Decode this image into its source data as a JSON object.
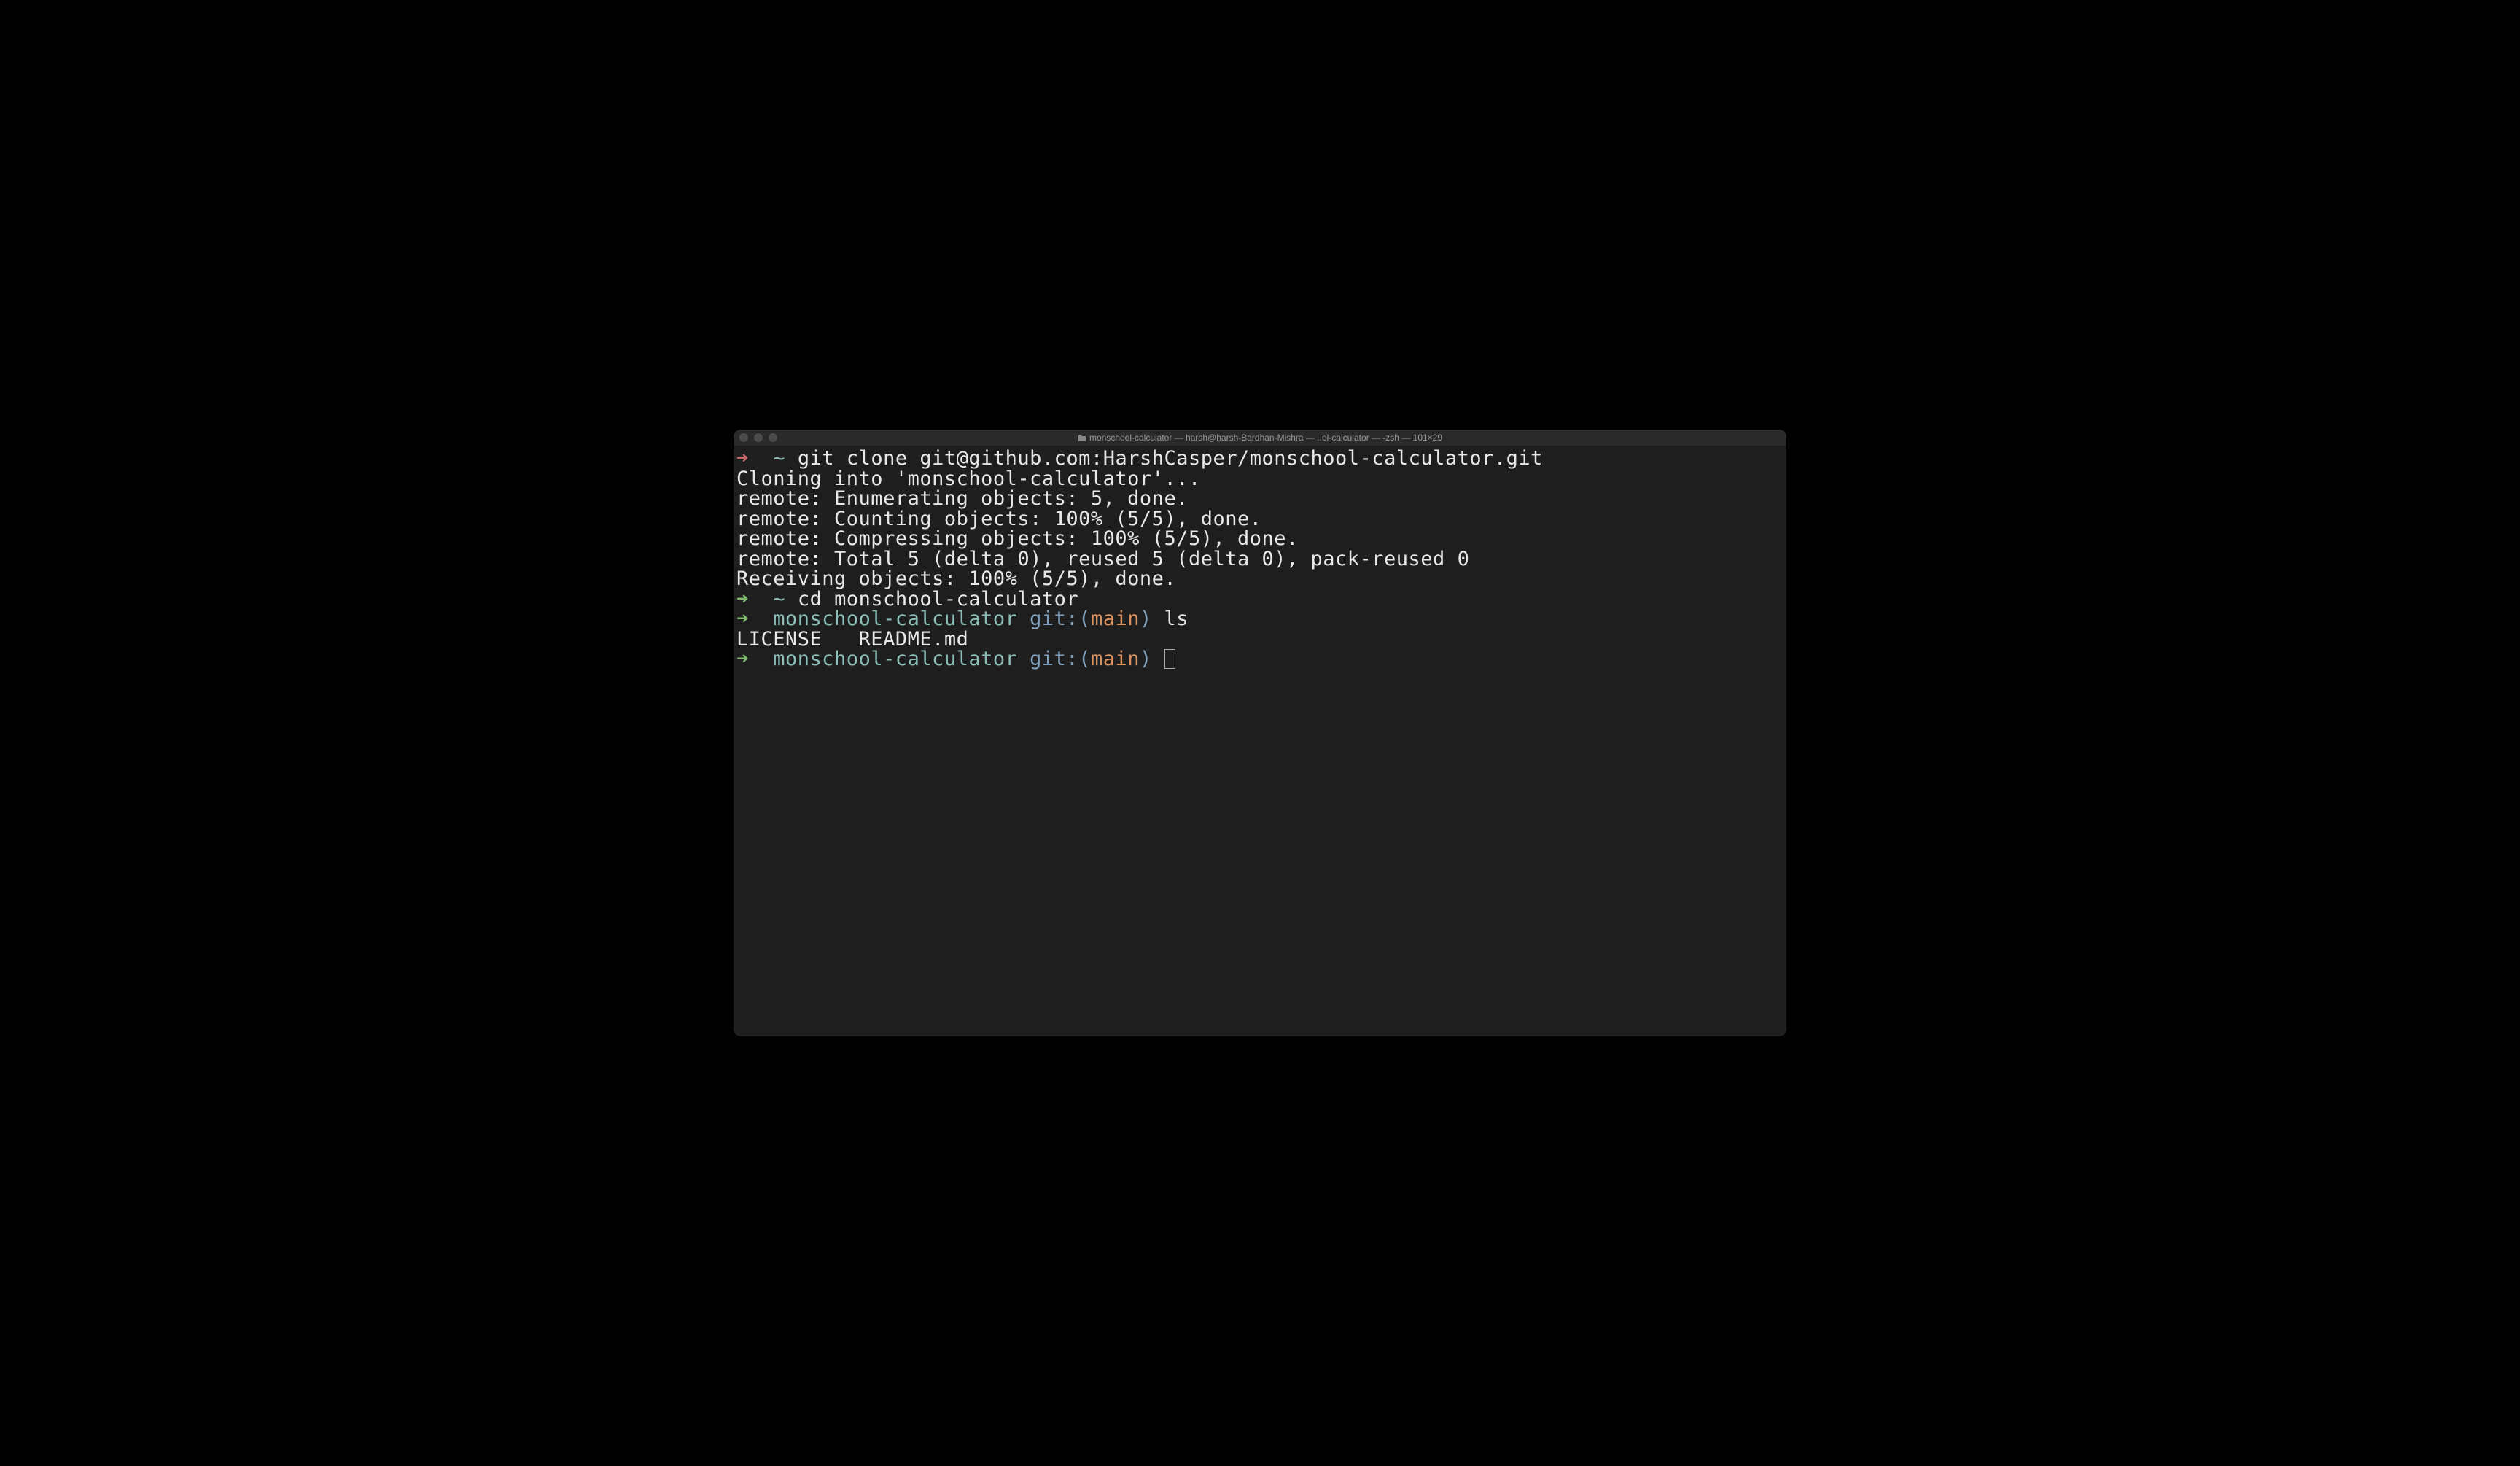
{
  "titlebar": {
    "title": "monschool-calculator — harsh@harsh-Bardhan-Mishra — ..ol-calculator — -zsh — 101×29"
  },
  "lines": {
    "l1_arrow": "➜",
    "l1_tilde": "~",
    "l1_cmd": "git clone git@github.com:HarshCasper/monschool-calculator.git",
    "l2": "Cloning into 'monschool-calculator'...",
    "l3": "remote: Enumerating objects: 5, done.",
    "l4": "remote: Counting objects: 100% (5/5), done.",
    "l5": "remote: Compressing objects: 100% (5/5), done.",
    "l6": "remote: Total 5 (delta 0), reused 5 (delta 0), pack-reused 0",
    "l7": "Receiving objects: 100% (5/5), done.",
    "l8_arrow": "➜",
    "l8_tilde": "~",
    "l8_cmd": "cd monschool-calculator",
    "l9_arrow": "➜",
    "l9_dir": "monschool-calculator",
    "l9_git": "git:(",
    "l9_branch": "main",
    "l9_close": ")",
    "l9_cmd": "ls",
    "l10": "LICENSE   README.md",
    "l11_arrow": "➜",
    "l11_dir": "monschool-calculator",
    "l11_git": "git:(",
    "l11_branch": "main",
    "l11_close": ")"
  }
}
